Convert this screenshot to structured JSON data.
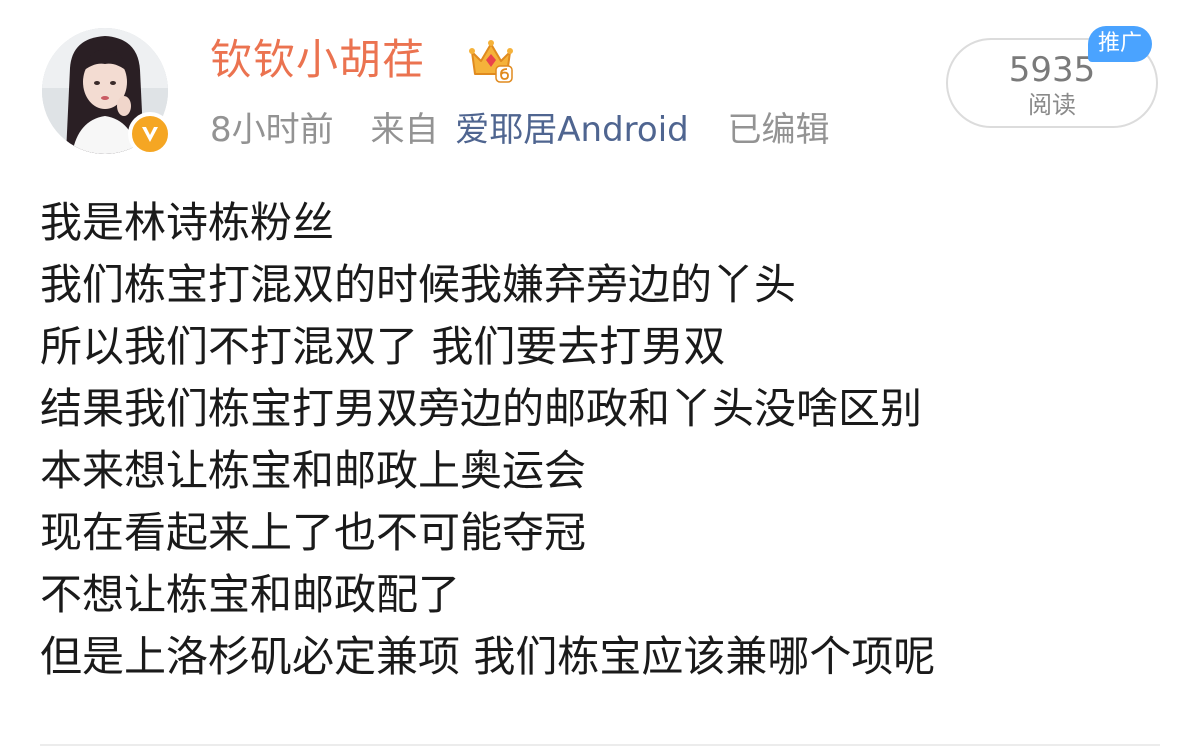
{
  "post": {
    "user_name": "钦钦小胡荏",
    "time": "8小时前",
    "source_prefix": "来自",
    "source_device": "爱耶居Android",
    "edited_label": "已编辑",
    "read_count": "5935",
    "read_label": "阅读",
    "promo_label": "推广",
    "lines": [
      "我是林诗栋粉丝",
      "我们栋宝打混双的时候我嫌弃旁边的丫头",
      "所以我们不打混双了 我们要去打男双",
      "结果我们栋宝打男双旁边的邮政和丫头没啥区别",
      "本来想让栋宝和邮政上奥运会",
      "现在看起来上了也不可能夺冠",
      "不想让栋宝和邮政配了",
      "但是上洛杉矶必定兼项 我们栋宝应该兼哪个项呢"
    ]
  },
  "icons": {
    "avatar": "user-avatar",
    "verified": "verified-v-badge",
    "crown": "crown-level-icon"
  },
  "colors": {
    "user_name": "#eb7350",
    "meta": "#939393",
    "device_link": "#4f6590",
    "text": "#1a1a1a",
    "promo_bg": "#4aa3ff",
    "verified": "#f5a623"
  }
}
